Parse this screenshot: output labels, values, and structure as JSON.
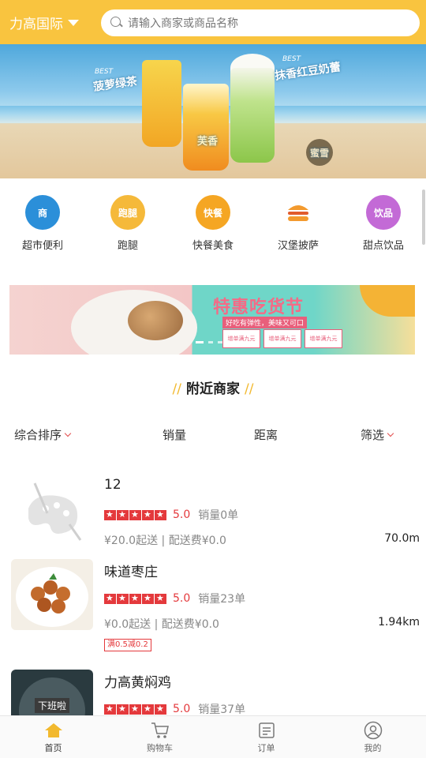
{
  "header": {
    "city": "力高国际",
    "search_placeholder": "请输入商家或商品名称"
  },
  "banner": {
    "tag_left": "菠萝绿茶",
    "tag_right": "抹香红豆奶蕾",
    "tag_center": "芙香",
    "best_mark": "BEST",
    "logo": "蜜雪"
  },
  "categories": [
    {
      "label": "超市便利",
      "icon": "shop-icon",
      "color": "#2b8fd9",
      "badge": "商"
    },
    {
      "label": "跑腿",
      "icon": "errand-icon",
      "color": "#f5b93a",
      "badge": "跑腿"
    },
    {
      "label": "快餐美食",
      "icon": "fastfood-icon",
      "color": "#f5a623",
      "badge": "快餐"
    },
    {
      "label": "汉堡披萨",
      "icon": "burger-icon",
      "color": "#f39a2e",
      "badge": ""
    },
    {
      "label": "甜点饮品",
      "icon": "drink-icon",
      "color": "#c36ad6",
      "badge": "饮品"
    }
  ],
  "promo": {
    "title": "特惠吃货节",
    "subtitle": "好吃有弹性，美味又可口",
    "cards": [
      "增单满九元",
      "增单满九元",
      "增单满九元"
    ]
  },
  "section": {
    "title": "附近商家"
  },
  "sort": {
    "comprehensive": "综合排序",
    "sales": "销量",
    "distance": "距离",
    "filter": "筛选"
  },
  "shops": [
    {
      "name": "12",
      "score": "5.0",
      "sales": "销量0单",
      "fee": "¥20.0起送 | 配送费¥0.0",
      "distance": "70.0m",
      "tag": ""
    },
    {
      "name": "味道枣庄",
      "score": "5.0",
      "sales": "销量23单",
      "fee": "¥0.0起送 | 配送费¥0.0",
      "distance": "1.94km",
      "tag": "满0.5减0.2"
    },
    {
      "name": "力高黄焖鸡",
      "score": "5.0",
      "sales": "销量37单",
      "fee": "",
      "distance": "",
      "tag": "",
      "thumb_text": "下班啦"
    }
  ],
  "bottom_nav": [
    {
      "label": "首页",
      "icon": "home-icon",
      "active": true
    },
    {
      "label": "购物车",
      "icon": "cart-icon",
      "active": false
    },
    {
      "label": "订单",
      "icon": "order-icon",
      "active": false
    },
    {
      "label": "我的",
      "icon": "profile-icon",
      "active": false
    }
  ],
  "colors": {
    "brand": "#f9c43f",
    "price_red": "#e4393c",
    "accent_gold": "#f2b92e"
  }
}
